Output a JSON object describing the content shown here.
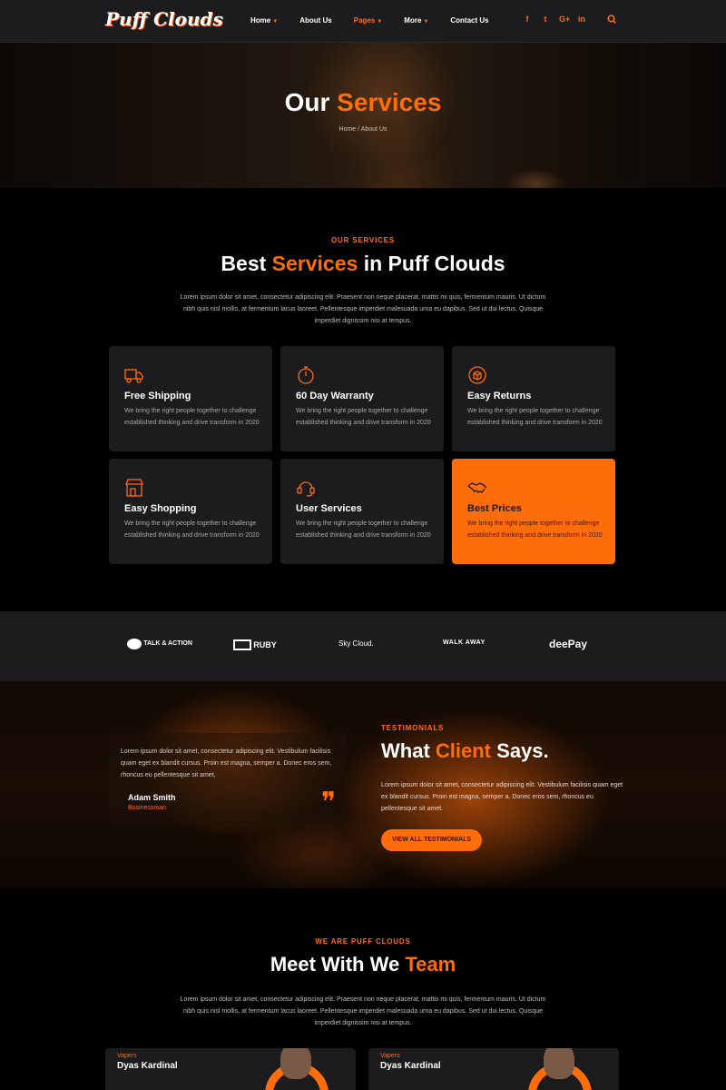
{
  "nav": {
    "logo": "Puff Clouds",
    "menu": [
      {
        "label": "Home",
        "caret": true
      },
      {
        "label": "About Us",
        "caret": false
      },
      {
        "label": "Pages",
        "caret": true,
        "active": true
      },
      {
        "label": "More",
        "caret": true
      },
      {
        "label": "Contact Us",
        "caret": false
      }
    ],
    "social": [
      "f",
      "t",
      "G+",
      "in"
    ]
  },
  "hero": {
    "title_a": "Our",
    "title_b": "Services",
    "breadcrumb": "Home / About Us"
  },
  "services": {
    "eyebrow": "OUR SERVICES",
    "title_a": "Best",
    "title_b": "Services",
    "title_c": "in Puff Clouds",
    "description": "Lorem ipsum dolor sit amet, consectetur adipiscing elit. Praesent non neque placerat, mattis mi quis, fermentum mauris. Ut dictum nibh quis nisl mollis, at fermentum lacus laoreet. Pellentesque imperdiet malesuada urna eu dapibus. Sed ut dui lectus. Quisque imperdiet dignissim nisi at tempus.",
    "cards": [
      {
        "title": "Free Shipping",
        "icon": "truck-icon",
        "text": "We bring the right people together to challenge established thinking and drive transform in 2020"
      },
      {
        "title": "60 Day Warranty",
        "icon": "stopwatch-icon",
        "text": "We bring the right people together to challenge established thinking and drive transform in 2020"
      },
      {
        "title": "Easy Returns",
        "icon": "box-return-icon",
        "text": "We bring the right people together to challenge established thinking and drive transform in 2020"
      },
      {
        "title": "Easy Shopping",
        "icon": "shop-icon",
        "text": "We bring the right people together to challenge established thinking and drive transform in 2020"
      },
      {
        "title": "User Services",
        "icon": "headset-icon",
        "text": "We bring the right people together to challenge established thinking and drive transform in 2020"
      },
      {
        "title": "Best Prices",
        "icon": "handshake-icon",
        "text": "We bring the right people together to challenge established thinking and drive transform in 2020"
      }
    ]
  },
  "brands": [
    "TALK & ACTION",
    "RUBY",
    "Sky Cloud.",
    "WALK AWAY",
    "deePay"
  ],
  "testimonials": {
    "quote": "Lorem ipsum dolor sit amet, consectetur adipiscing elit. Vestibulum facilisis quam eget ex blandit cursus. Proin est magna, semper a. Donec eros sem, rhoncus eu pellentesque sit amet,",
    "name": "Adam Smith",
    "role": "Businessman",
    "eyebrow": "TESTIMONIALS",
    "title_a": "What",
    "title_b": "Client",
    "title_c": "Says.",
    "description": "Lorem ipsum dolor sit amet, consectetur adipiscing elit. Vestibulum facilisis quam eget ex blandit cursus. Proin est magna, semper a. Donec eros sem, rhoncus eu pellentesque sit amet.",
    "button": "VIEW ALL TESTIMONIALS"
  },
  "team": {
    "eyebrow": "WE ARE PUFF CLOUDS",
    "title_a": "Meet With We",
    "title_b": "Team",
    "description": "Lorem ipsum dolor sit amet, consectetur adipiscing elit. Praesent non neque placerat, mattis mi quis, fermentum mauris. Ut dictum nibh quis nisl mollis, at fermentum lacus laoreet. Pellentesque imperdiet malesuada urna eu dapibus. Sed ut dui lectus. Quisque imperdiet dignissim nisi at tempus.",
    "members": [
      {
        "role": "Vapers",
        "name": "Dyas Kardinal"
      },
      {
        "role": "Vapers",
        "name": "Dyas Kardinal"
      }
    ]
  },
  "colors": {
    "accent": "#ff6c0a",
    "card": "#1c1c1e",
    "background": "#000000"
  }
}
